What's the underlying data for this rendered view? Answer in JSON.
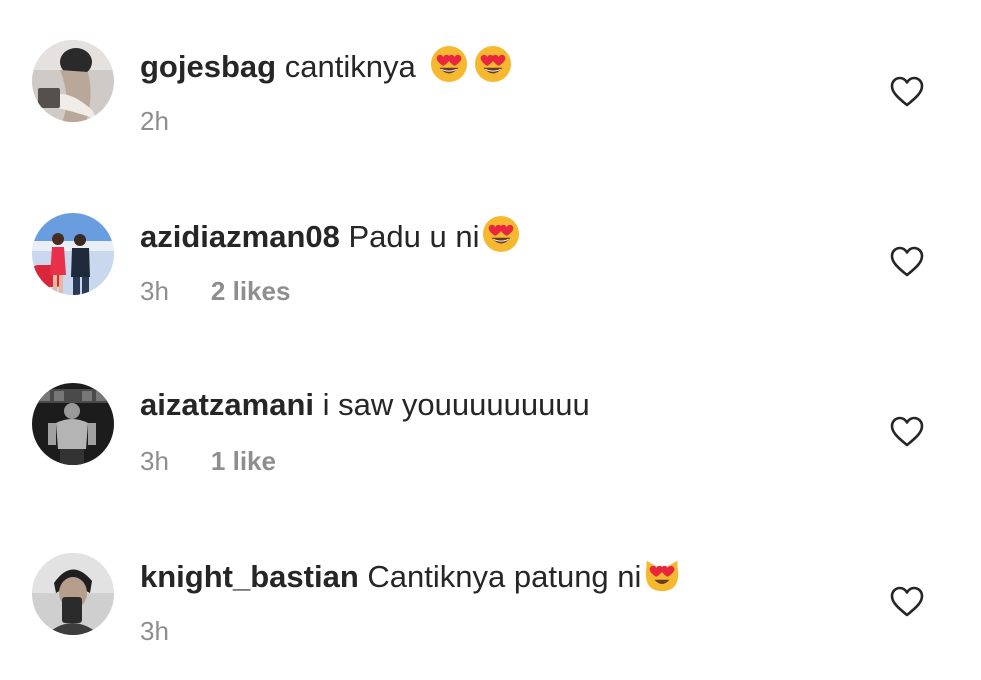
{
  "comments": [
    {
      "username": "gojesbag",
      "text": "cantiknya",
      "emojis": [
        "heart-eyes-emoji",
        "heart-eyes-emoji"
      ],
      "time": "2h",
      "likes": ""
    },
    {
      "username": "azidiazman08",
      "text": "Padu u ni",
      "emojis": [
        "heart-eyes-emoji"
      ],
      "time": "3h",
      "likes": "2 likes"
    },
    {
      "username": "aizatzamani",
      "text": "i saw youuuuuuuuu",
      "emojis": [],
      "time": "3h",
      "likes": "1 like"
    },
    {
      "username": "knight_bastian",
      "text": "Cantiknya patung ni",
      "emojis": [
        "heart-eyes-cat-emoji"
      ],
      "time": "3h",
      "likes": ""
    }
  ],
  "icons": {
    "like": "heart-outline-icon"
  },
  "colors": {
    "username": "#262626",
    "meta": "#8e8e8e",
    "heart_outline": "#262626",
    "emoji_face": "#f5b82e",
    "emoji_heart": "#e8263f"
  }
}
